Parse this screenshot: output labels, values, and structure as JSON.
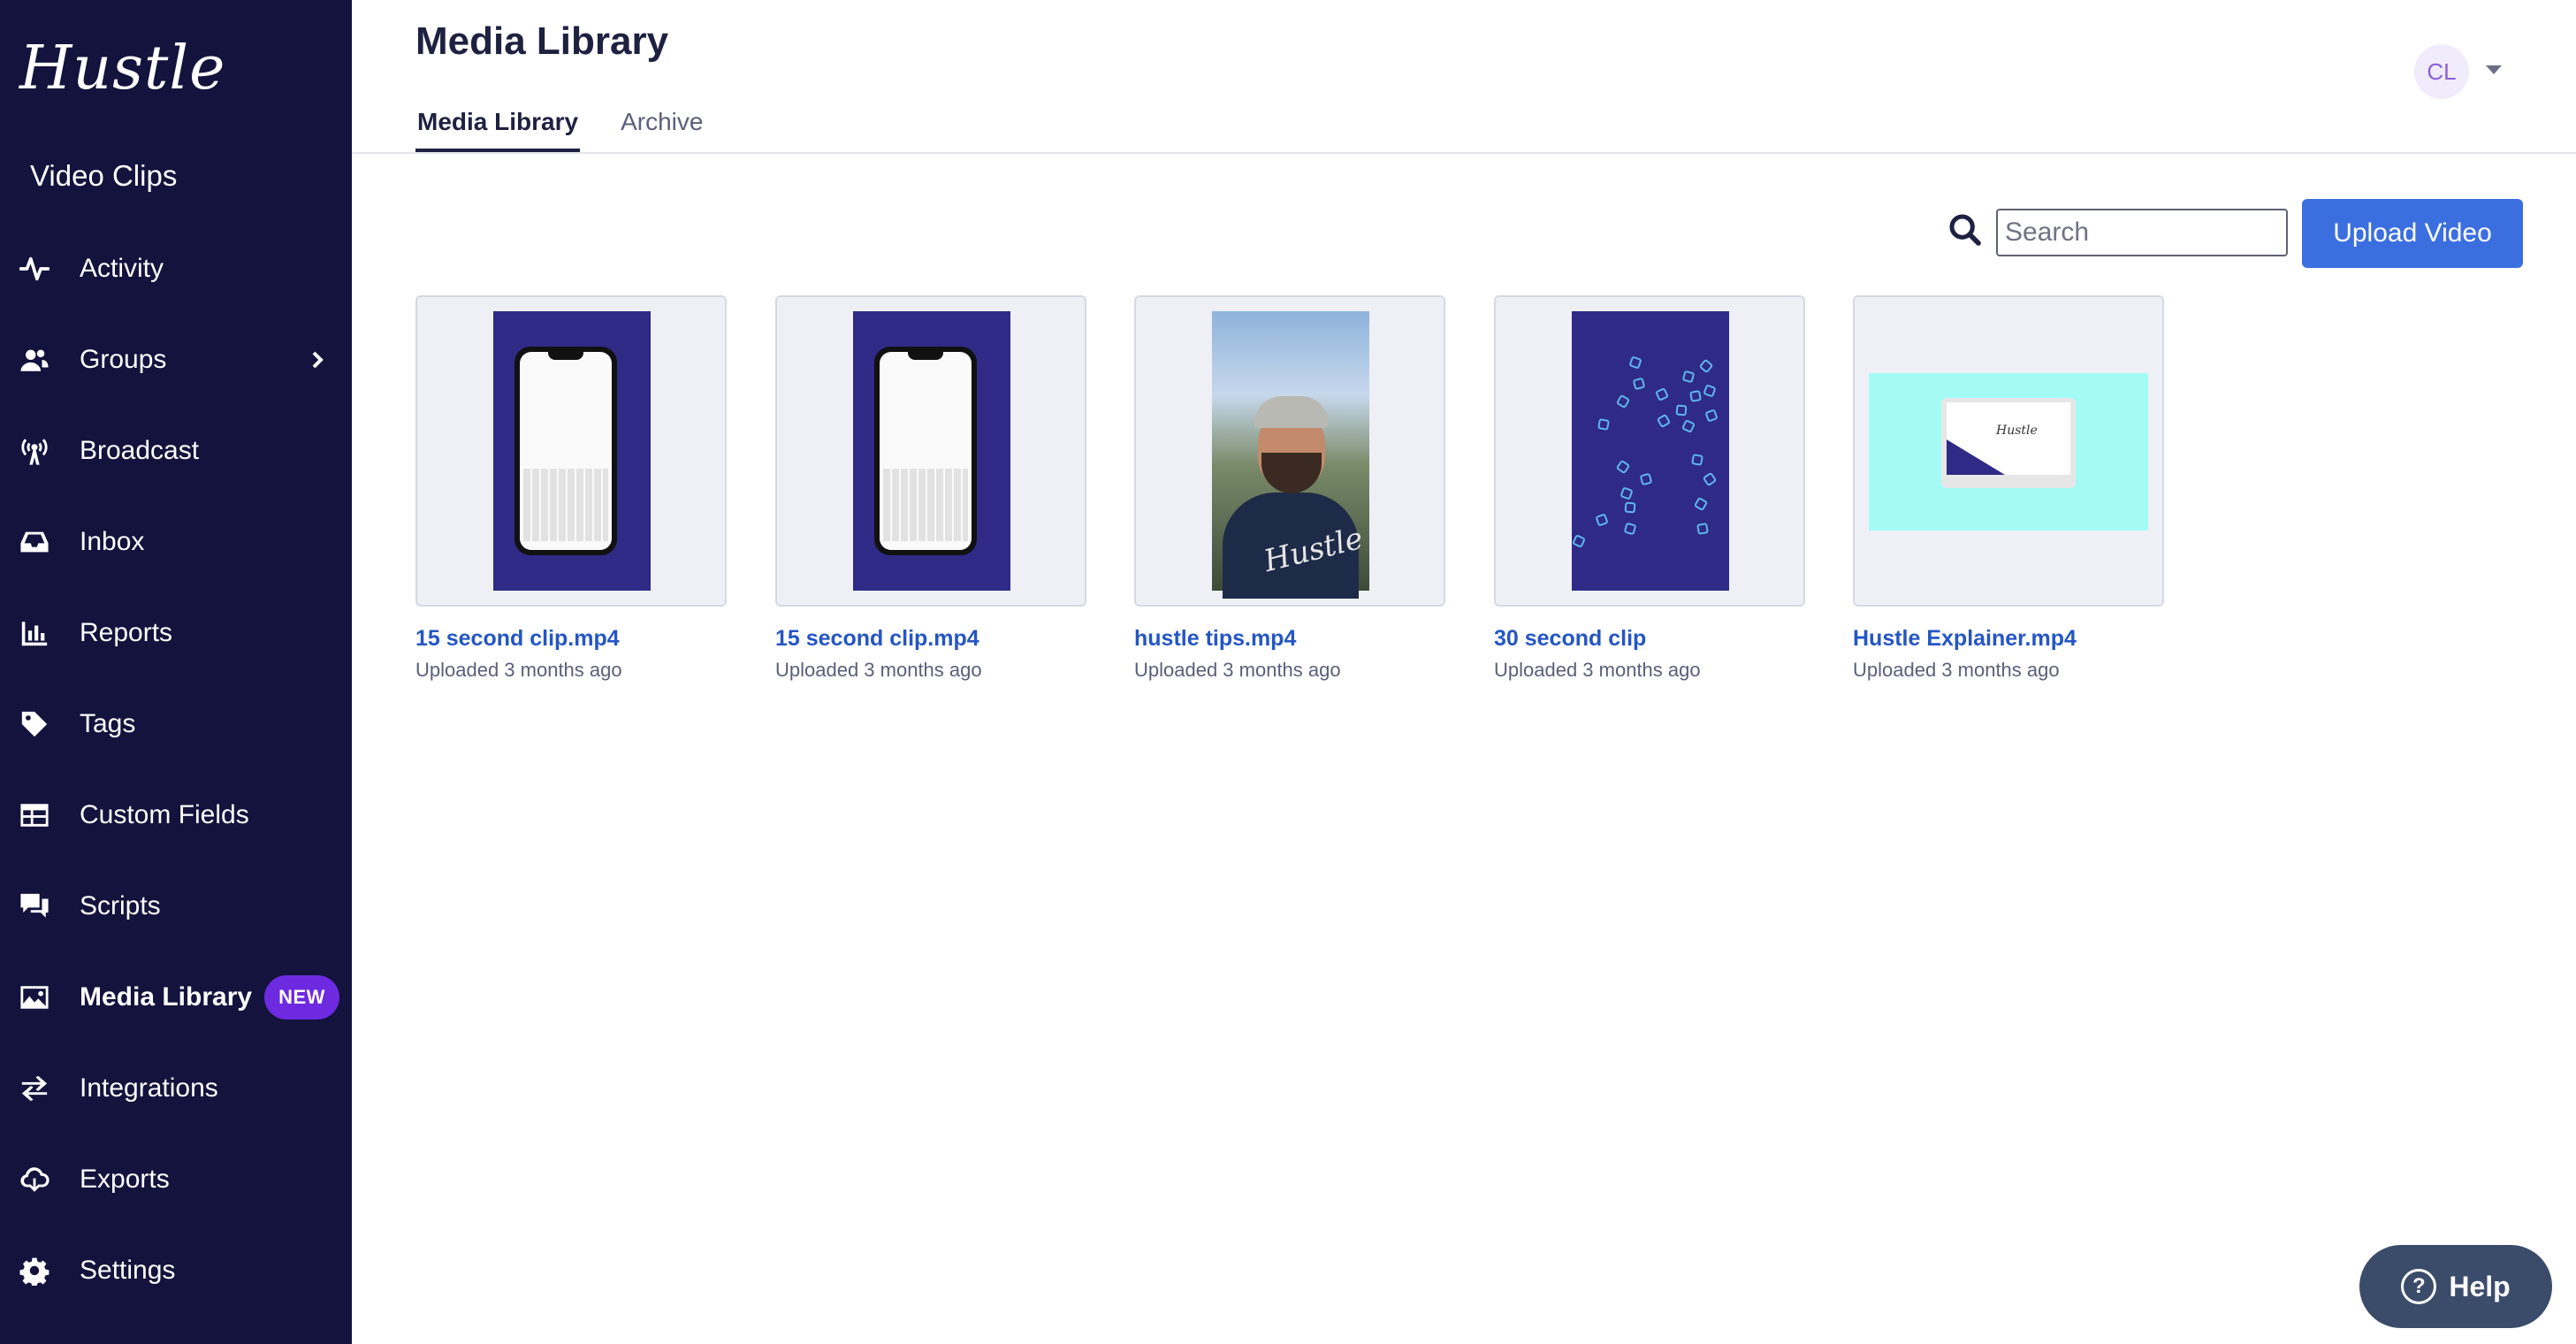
{
  "app": {
    "logo": "Hustle",
    "section": "Video Clips"
  },
  "sidebar": {
    "items": [
      {
        "label": "Activity"
      },
      {
        "label": "Groups"
      },
      {
        "label": "Broadcast"
      },
      {
        "label": "Inbox"
      },
      {
        "label": "Reports"
      },
      {
        "label": "Tags"
      },
      {
        "label": "Custom Fields"
      },
      {
        "label": "Scripts"
      },
      {
        "label": "Media Library",
        "badge": "NEW"
      },
      {
        "label": "Integrations"
      },
      {
        "label": "Exports"
      },
      {
        "label": "Settings"
      }
    ]
  },
  "header": {
    "title": "Media Library",
    "tabs": [
      {
        "label": "Media Library"
      },
      {
        "label": "Archive"
      }
    ],
    "user_initials": "CL"
  },
  "toolbar": {
    "search_placeholder": "Search",
    "upload_label": "Upload Video"
  },
  "media": [
    {
      "title": "15 second clip.mp4",
      "uploaded": "Uploaded 3 months ago"
    },
    {
      "title": "15 second clip.mp4",
      "uploaded": "Uploaded 3 months ago"
    },
    {
      "title": "hustle tips.mp4",
      "uploaded": "Uploaded 3 months ago",
      "shirt_text": "Hustle"
    },
    {
      "title": "30 second clip",
      "uploaded": "Uploaded 3 months ago"
    },
    {
      "title": "Hustle Explainer.mp4",
      "uploaded": "Uploaded 3 months ago",
      "screen_text": "Hustle"
    }
  ],
  "help": {
    "label": "Help"
  },
  "colors": {
    "sidebar": "#13133d",
    "accent": "#3b6fe0",
    "badge": "#6d2ae0",
    "link": "#2456c4"
  }
}
